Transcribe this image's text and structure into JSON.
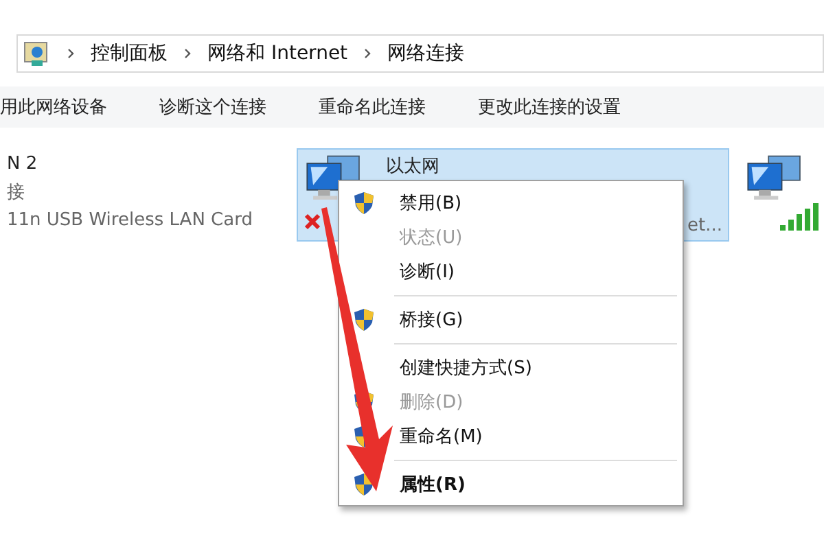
{
  "address_bar": {
    "crumbs": [
      "控制面板",
      "网络和 Internet",
      "网络连接"
    ]
  },
  "toolbar": {
    "commands": [
      "用此网络设备",
      "诊断这个连接",
      "重命名此连接",
      "更改此连接的设置"
    ]
  },
  "connections": [
    {
      "name": "N 2",
      "status": "接",
      "device": "11n USB Wireless LAN Card",
      "selected": false,
      "kind": "wifi-cut"
    },
    {
      "name": "以太网",
      "device": "et...",
      "selected": true,
      "kind": "ethernet"
    },
    {
      "selected": false,
      "kind": "wifi-icon-only"
    }
  ],
  "context_menu": {
    "items": [
      {
        "label": "禁用(B)",
        "shield": true,
        "disabled": false,
        "default": false,
        "separator_after": false
      },
      {
        "label": "状态(U)",
        "shield": false,
        "disabled": true,
        "default": false,
        "separator_after": false
      },
      {
        "label": "诊断(I)",
        "shield": false,
        "disabled": false,
        "default": false,
        "separator_after": true
      },
      {
        "label": "桥接(G)",
        "shield": true,
        "disabled": false,
        "default": false,
        "separator_after": true
      },
      {
        "label": "创建快捷方式(S)",
        "shield": false,
        "disabled": false,
        "default": false,
        "separator_after": false
      },
      {
        "label": "删除(D)",
        "shield": true,
        "disabled": true,
        "default": false,
        "separator_after": false
      },
      {
        "label": "重命名(M)",
        "shield": true,
        "disabled": false,
        "default": false,
        "separator_after": true
      },
      {
        "label": "属性(R)",
        "shield": true,
        "disabled": false,
        "default": true,
        "separator_after": false
      }
    ]
  }
}
